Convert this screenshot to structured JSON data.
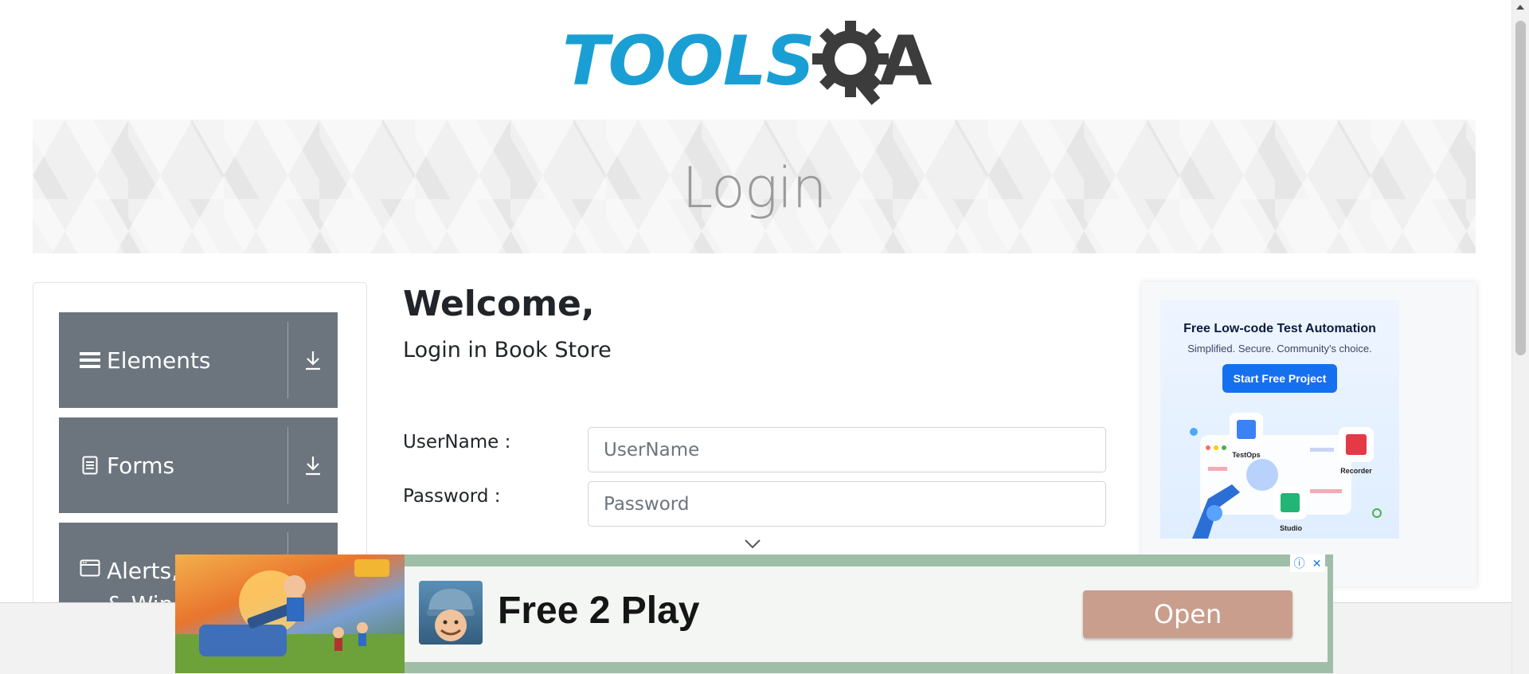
{
  "logo": {
    "text_left": "TOOLS",
    "text_right": "A"
  },
  "banner": {
    "title": "Login"
  },
  "sidebar": {
    "groups": [
      {
        "label": "Elements",
        "icon": "menu-icon"
      },
      {
        "label": "Forms",
        "icon": "document-icon"
      },
      {
        "label": "Alerts, Frame & Windows",
        "icon": "window-icon"
      }
    ]
  },
  "main": {
    "welcome": "Welcome,",
    "subtitle": "Login in Book Store",
    "username": {
      "label": "UserName :",
      "placeholder": "UserName",
      "value": ""
    },
    "password": {
      "label": "Password :",
      "placeholder": "Password",
      "value": ""
    }
  },
  "right_ad": {
    "title": "Free Low-code Test Automation",
    "subtitle": "Simplified. Secure. Community's choice.",
    "button": "Start Free Project",
    "products": [
      "TestOps",
      "Recorder",
      "Studio"
    ]
  },
  "bottom_ad": {
    "headline": "Free 2 Play",
    "button": "Open"
  },
  "colors": {
    "brand_blue": "#1a9fd4",
    "sidebar_gray": "#6c757d",
    "ad_button": "#c99e8d"
  }
}
